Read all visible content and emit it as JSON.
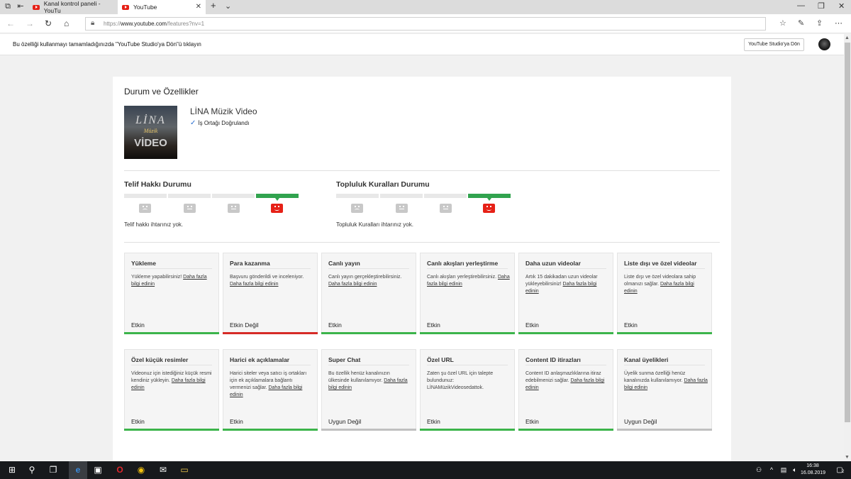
{
  "browser": {
    "tabs": [
      {
        "label": "Kanal kontrol paneli - YouTu",
        "active": false
      },
      {
        "label": "YouTube",
        "active": true
      }
    ],
    "url_prefix": "https://",
    "url_host": "www.youtube.com",
    "url_path": "/features?nv=1"
  },
  "notice": {
    "message": "Bu özelliği kullanmayı tamamladığınızda \"YouTube Studio'ya Dön\"ü tıklayın",
    "button": "YouTube Studio'ya Dön"
  },
  "page": {
    "title": "Durum ve Özellikler",
    "channel_name": "LİNA Müzik Video",
    "verified_label": "İş Ortağı Doğrulandı",
    "thumbnail_text": {
      "line1": "LİNA",
      "line2": "Müzik",
      "line3": "VİDEO"
    }
  },
  "copyright": {
    "title": "Telif Hakkı Durumu",
    "text": "Telif hakkı ihtarınız yok.",
    "level": 4,
    "levels_total": 4
  },
  "community": {
    "title": "Topluluk Kuralları Durumu",
    "text": "Topluluk Kuralları ihtarınız yok.",
    "level": 4,
    "levels_total": 4
  },
  "features": [
    {
      "title": "Yükleme",
      "desc": "Yükleme yapabilirsiniz!",
      "link": "Daha fazla bilgi edinin",
      "status": "Etkin",
      "state": "green"
    },
    {
      "title": "Para kazanma",
      "desc": "Başvuru gönderildi ve inceleniyor.",
      "link": "Daha fazla bilgi edinin",
      "status": "Etkin Değil",
      "state": "red"
    },
    {
      "title": "Canlı yayın",
      "desc": "Canlı yayın gerçekleştirebilirsiniz.",
      "link": "Daha fazla bilgi edinin",
      "status": "Etkin",
      "state": "green"
    },
    {
      "title": "Canlı akışları yerleştirme",
      "desc": "Canlı akışları yerleştirebilirsiniz.",
      "link": "Daha fazla bilgi edinin",
      "status": "Etkin",
      "state": "green"
    },
    {
      "title": "Daha uzun videolar",
      "desc": "Artık 15 dakikadan uzun videolar yükleyebilirsiniz!",
      "link": "Daha fazla bilgi edinin",
      "status": "Etkin",
      "state": "green"
    },
    {
      "title": "Liste dışı ve özel videolar",
      "desc": "Liste dışı ve özel videolara sahip olmanızı sağlar.",
      "link": "Daha fazla bilgi edinin",
      "status": "Etkin",
      "state": "green"
    },
    {
      "title": "Özel küçük resimler",
      "desc": "Videonuz için istediğiniz küçük resmi kendiniz yükleyin.",
      "link": "Daha fazla bilgi edinin",
      "status": "Etkin",
      "state": "green"
    },
    {
      "title": "Harici ek açıklamalar",
      "desc": "Harici siteler veya satıcı iş ortakları için ek açıklamalara bağlantı vermenizi sağlar.",
      "link": "Daha fazla bilgi edinin",
      "status": "Etkin",
      "state": "green"
    },
    {
      "title": "Super Chat",
      "desc": "Bu özellik henüz kanalınızın ülkesinde kullanılamıyor.",
      "link": "Daha fazla bilgi edinin",
      "status": "Uygun Değil",
      "state": "grey"
    },
    {
      "title": "Özel URL",
      "desc": "Zaten şu özel URL için talepte bulundunuz: LİNAMüzikVideosedattok.",
      "link": "",
      "status": "Etkin",
      "state": "green"
    },
    {
      "title": "Content ID itirazları",
      "desc": "Content ID anlaşmazlıklarına itiraz edebilmenizi sağlar.",
      "link": "Daha fazla bilgi edinin",
      "status": "Etkin",
      "state": "green"
    },
    {
      "title": "Kanal üyelikleri",
      "desc": "Üyelik sunma özelliği henüz kanalınızda kullanılamıyor.",
      "link": "Daha fazla bilgi edinin",
      "status": "Uygun Değil",
      "state": "grey"
    }
  ],
  "taskbar": {
    "time": "16:38",
    "date": "16.08.2019",
    "notification_count": "2"
  },
  "colors": {
    "active": "#3cb44b",
    "inactive": "#d62b27",
    "unavailable": "#c0c0c0",
    "youtube_red": "#e62117"
  }
}
